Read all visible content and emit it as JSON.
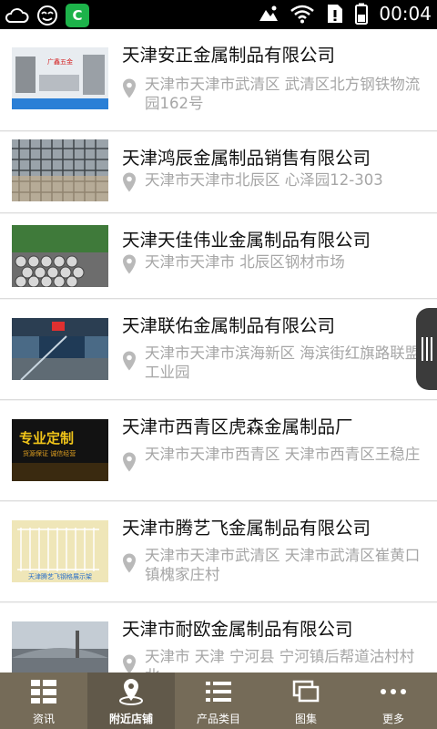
{
  "status_bar": {
    "time": "00:04"
  },
  "companies": [
    {
      "name": "天津安正金属制品有限公司",
      "address": "天津市天津市武清区 武清区北方钢铁物流园162号"
    },
    {
      "name": "天津鸿辰金属制品销售有限公司",
      "address": "天津市天津市北辰区 心泽园12-303"
    },
    {
      "name": "天津天佳伟业金属制品有限公司",
      "address": "天津市天津市 北辰区钢材市场"
    },
    {
      "name": "天津联佑金属制品有限公司",
      "address": "天津市天津市滨海新区 海滨街红旗路联盟工业园"
    },
    {
      "name": "天津市西青区虎森金属制品厂",
      "address": "天津市天津市西青区 天津市西青区王稳庄"
    },
    {
      "name": "天津市腾艺飞金属制品有限公司",
      "address": "天津市天津市武清区 天津市武清区崔黄口镇槐家庄村"
    },
    {
      "name": "天津市耐欧金属制品有限公司",
      "address": "天津市 天津 宁河县 宁河镇后帮道沽村村北"
    }
  ],
  "thumb_texts": {
    "t0": "广鑫五金",
    "t4_line1": "专业定制",
    "t4_line2": "货源保证 诚信经营",
    "t5": "天津腾艺飞钢格展示架"
  },
  "tabbar": [
    {
      "label": "资讯",
      "icon": "grid-icon"
    },
    {
      "label": "附近店铺",
      "icon": "location-pin-icon",
      "active": true
    },
    {
      "label": "产品类目",
      "icon": "list-icon"
    },
    {
      "label": "图集",
      "icon": "gallery-icon"
    },
    {
      "label": "更多",
      "icon": "more-dots-icon"
    }
  ],
  "colors": {
    "tabbar_bg": "#756b58",
    "tabbar_active": "#61594a",
    "address_gray": "#a6a6a6"
  }
}
